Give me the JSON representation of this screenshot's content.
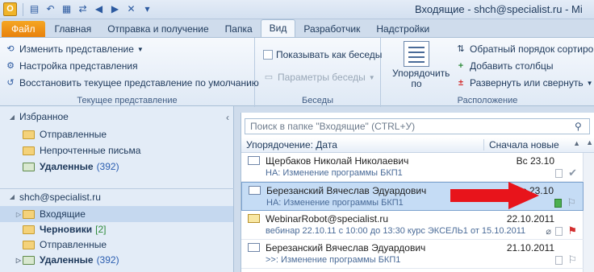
{
  "titlebar": {
    "app_icon_letter": "O",
    "title": "Входящие - shch@specialist.ru  -  Mi"
  },
  "tabs": [
    "Файл",
    "Главная",
    "Отправка и получение",
    "Папка",
    "Вид",
    "Разработчик",
    "Надстройки"
  ],
  "ribbon": {
    "current_view": {
      "change_view": "Изменить представление",
      "view_settings": "Настройка представления",
      "reset_view": "Восстановить текущее представление по умолчанию",
      "label": "Текущее представление"
    },
    "conversations": {
      "show_as_conversations": "Показывать как беседы",
      "conversation_settings": "Параметры беседы",
      "label": "Беседы"
    },
    "arrangement": {
      "arrange_by": "Упорядочить по",
      "reverse_sort": "Обратный порядок сортиро",
      "add_columns": "Добавить столбцы",
      "expand_collapse": "Развернуть или свернуть",
      "label": "Расположение"
    }
  },
  "nav": {
    "favorites_header": "Избранное",
    "favorites": [
      {
        "label": "Отправленные",
        "count": ""
      },
      {
        "label": "Непрочтенные письма",
        "count": ""
      },
      {
        "label": "Удаленные",
        "count": "(392)"
      }
    ],
    "account_header": "shch@specialist.ru",
    "folders": [
      {
        "label": "Входящие",
        "count": ""
      },
      {
        "label": "Черновики",
        "count": "[2]"
      },
      {
        "label": "Отправленные",
        "count": ""
      },
      {
        "label": "Удаленные",
        "count": "(392)"
      }
    ]
  },
  "list": {
    "search_placeholder": "Поиск в папке \"Входящие\" (CTRL+У)",
    "sort_by": "Упорядочение: Дата",
    "order": "Сначала новые",
    "messages": [
      {
        "sender": "Щербаков Николай Николаевич",
        "subject": "НА: Изменение программы БКП1",
        "date": "Вс 23.10"
      },
      {
        "sender": "Березанский Вячеслав Эдуардович",
        "subject": "НА: Изменение программы БКП1",
        "date": "Вс 23.10"
      },
      {
        "sender": "WebinarRobot@specialist.ru",
        "subject": "вебинар 22.10.11 с 10:00 до 13:30  курс ЭКСЕЛЬ1 от 15.10.2011",
        "date": "22.10.2011"
      },
      {
        "sender": "Березанский Вячеслав Эдуардович",
        "subject": ">>: Изменение программы БКП1",
        "date": "21.10.2011"
      }
    ]
  },
  "colors": {
    "file_tab": "#e8810c",
    "selection": "#c5dcf5",
    "annotation_arrow": "#e8141b"
  }
}
